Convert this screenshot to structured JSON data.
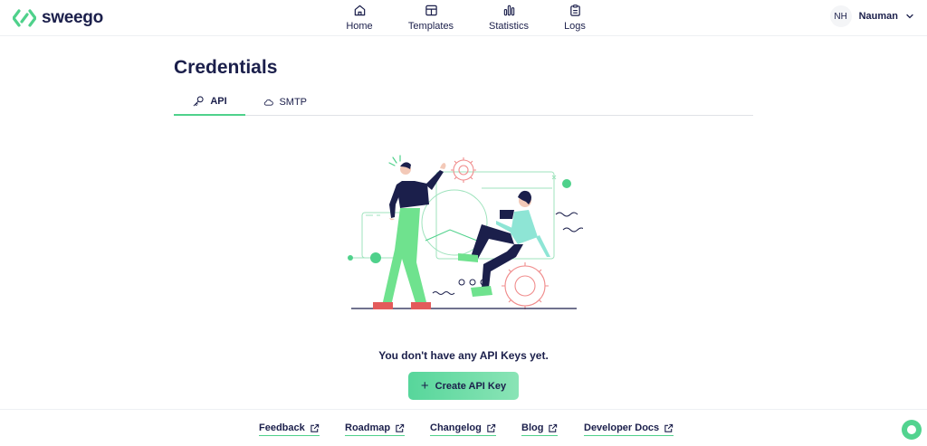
{
  "app": {
    "logo_text": "sweego"
  },
  "nav": {
    "items": [
      {
        "label": "Home",
        "icon": "home-icon"
      },
      {
        "label": "Templates",
        "icon": "layout-icon"
      },
      {
        "label": "Statistics",
        "icon": "bar-chart-icon"
      },
      {
        "label": "Logs",
        "icon": "clipboard-icon"
      }
    ]
  },
  "user": {
    "initials": "NH",
    "name": "Nauman"
  },
  "page": {
    "title": "Credentials",
    "tabs": [
      {
        "label": "API",
        "icon": "key-icon",
        "active": true
      },
      {
        "label": "SMTP",
        "icon": "cloud-icon",
        "active": false
      }
    ],
    "empty_message": "You don't have any API Keys yet.",
    "create_button": "Create API Key"
  },
  "footer": {
    "links": [
      {
        "label": "Feedback"
      },
      {
        "label": "Roadmap"
      },
      {
        "label": "Changelog"
      },
      {
        "label": "Blog"
      },
      {
        "label": "Developer Docs"
      }
    ]
  },
  "colors": {
    "accent": "#4fd18b",
    "text": "#1b1f4b",
    "illustration_red": "#e35b5b"
  }
}
